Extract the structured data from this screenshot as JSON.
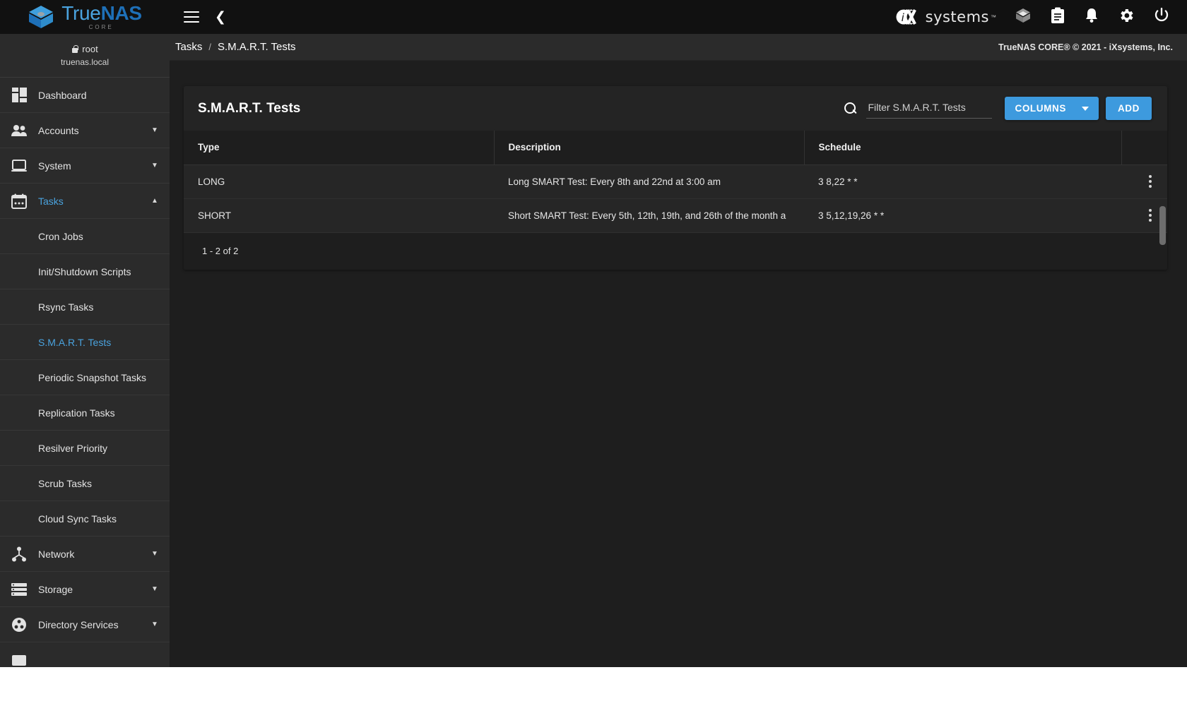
{
  "topbar": {
    "brand": {
      "name_part1": "True",
      "name_part2": "NAS",
      "subtitle": "CORE"
    },
    "menu_icon": "hamburger-icon",
    "back_icon": "chevron-left-icon",
    "vendor": {
      "word": "systems",
      "tm": "™"
    },
    "icons": [
      "cube-icon",
      "clipboard-icon",
      "bell-icon",
      "gear-icon",
      "power-icon"
    ]
  },
  "sidebar": {
    "user": {
      "name": "root",
      "host": "truenas.local"
    },
    "items": [
      {
        "label": "Dashboard",
        "icon": "dashboard-icon",
        "expandable": false,
        "active": false
      },
      {
        "label": "Accounts",
        "icon": "accounts-icon",
        "expandable": true,
        "expanded": false,
        "active": false
      },
      {
        "label": "System",
        "icon": "system-icon",
        "expandable": true,
        "expanded": false,
        "active": false
      },
      {
        "label": "Tasks",
        "icon": "calendar-icon",
        "expandable": true,
        "expanded": true,
        "active": true
      }
    ],
    "task_children": [
      {
        "label": "Cron Jobs",
        "active": false
      },
      {
        "label": "Init/Shutdown Scripts",
        "active": false
      },
      {
        "label": "Rsync Tasks",
        "active": false
      },
      {
        "label": "S.M.A.R.T. Tests",
        "active": true
      },
      {
        "label": "Periodic Snapshot Tasks",
        "active": false
      },
      {
        "label": "Replication Tasks",
        "active": false
      },
      {
        "label": "Resilver Priority",
        "active": false
      },
      {
        "label": "Scrub Tasks",
        "active": false
      },
      {
        "label": "Cloud Sync Tasks",
        "active": false
      }
    ],
    "items_after": [
      {
        "label": "Network",
        "icon": "network-icon",
        "expandable": true,
        "expanded": false,
        "active": false
      },
      {
        "label": "Storage",
        "icon": "storage-icon",
        "expandable": true,
        "expanded": false,
        "active": false
      },
      {
        "label": "Directory Services",
        "icon": "directory-services-icon",
        "expandable": true,
        "expanded": false,
        "active": false
      }
    ]
  },
  "breadcrumb": {
    "parent": "Tasks",
    "separator": "/",
    "current": "S.M.A.R.T. Tests",
    "copyright": "TrueNAS CORE® © 2021 - iXsystems, Inc."
  },
  "card": {
    "title": "S.M.A.R.T. Tests",
    "search_placeholder": "Filter S.M.A.R.T. Tests",
    "search_value": "",
    "columns_label": "COLUMNS",
    "add_label": "ADD"
  },
  "table": {
    "headers": [
      "Type",
      "Description",
      "Schedule"
    ],
    "rows": [
      {
        "type": "LONG",
        "description": "Long SMART Test: Every 8th and 22nd at 3:00 am",
        "schedule": "3 8,22 * *"
      },
      {
        "type": "SHORT",
        "description": "Short SMART Test: Every 5th, 12th, 19th, and 26th of the month a",
        "schedule": "3 5,12,19,26 * *"
      }
    ],
    "paginator": "1 - 2 of 2"
  },
  "colors": {
    "accent": "#3d9ade",
    "link": "#4aa3df",
    "topbar_bg": "#111111",
    "sidebar_bg": "#2b2b2b",
    "content_bg": "#1e1e1e",
    "card_bg": "#242424"
  }
}
